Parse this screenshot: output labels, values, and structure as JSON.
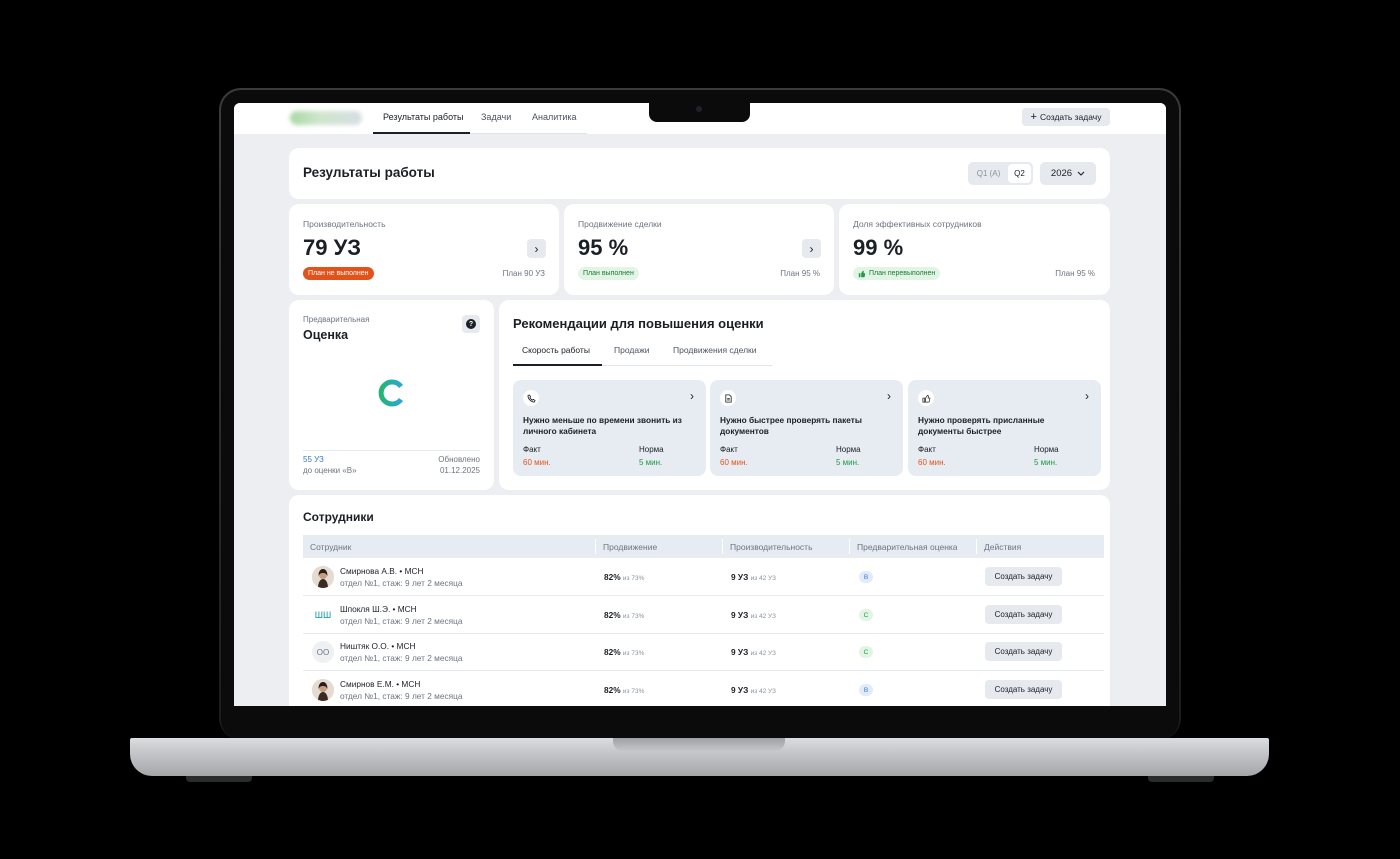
{
  "nav": {
    "tabs": [
      "Результаты работы",
      "Задачи",
      "Аналитика"
    ],
    "create_task": "Создать задачу"
  },
  "header": {
    "title": "Результаты работы",
    "periods": [
      "Q1 (А)",
      "Q2"
    ],
    "selected_period": "Q2",
    "year": "2026"
  },
  "kpis": [
    {
      "label": "Производительность",
      "value": "79 УЗ",
      "badge": "План не выполнен",
      "badge_status": "red",
      "plan": "План 90 УЗ"
    },
    {
      "label": "Продвижение сделки",
      "value": "95 %",
      "badge": "План выполнен",
      "badge_status": "green",
      "plan": "План 95 %"
    },
    {
      "label": "Доля эффективных сотрудников",
      "value": "99 %",
      "badge": "План перевыполнен",
      "badge_status": "green",
      "plan": "План 95 %"
    }
  ],
  "score": {
    "label": "Предварительная",
    "title": "Оценка",
    "grade": "C",
    "remaining": "55 УЗ",
    "remaining_sub": "до оценки «B»",
    "updated_label": "Обновлено",
    "updated_date": "01.12.2025"
  },
  "recommendations": {
    "title": "Рекомендации для повышения оценки",
    "tabs": [
      "Скорость работы",
      "Продажи",
      "Продвижения сделки"
    ],
    "cards": [
      {
        "icon": "phone-icon",
        "text": "Нужно меньше по времени звонить из личного кабинета",
        "fact_label": "Факт",
        "fact": "60 мин.",
        "norm_label": "Норма",
        "norm": "5 мин."
      },
      {
        "icon": "document-icon",
        "text": "Нужно быстрее проверять пакеты документов",
        "fact_label": "Факт",
        "fact": "60 мин.",
        "norm_label": "Норма",
        "norm": "5 мин."
      },
      {
        "icon": "thumbs-up-icon",
        "text": "Нужно проверять присланные документы быстрее",
        "fact_label": "Факт",
        "fact": "60 мин.",
        "norm_label": "Норма",
        "norm": "5 мин."
      }
    ]
  },
  "employees": {
    "title": "Сотрудники",
    "columns": [
      "Сотрудник",
      "Продвижение",
      "Производительность",
      "Предварительная оценка",
      "Действия"
    ],
    "rows": [
      {
        "avatar": "photo",
        "initials": "",
        "name": "Смирнова А.В. • МСН",
        "dept": "отдел №1, стаж: 9 лет 2 месяца",
        "promo": "82%",
        "promo_of": "из 73%",
        "prod": "9 УЗ",
        "prod_of": "из 42 УЗ",
        "grade": "B",
        "action": "Создать задачу"
      },
      {
        "avatar": "initials-cyan",
        "initials": "ШШ",
        "name": "Шпокля Ш.Э. • МСН",
        "dept": "отдел №1, стаж: 9 лет 2 месяца",
        "promo": "82%",
        "promo_of": "из 73%",
        "prod": "9 УЗ",
        "prod_of": "из 42 УЗ",
        "grade": "C",
        "action": "Создать задачу"
      },
      {
        "avatar": "initials-gray",
        "initials": "ОО",
        "name": "Ништяк О.О. • МСН",
        "dept": "отдел №1, стаж: 9 лет 2 месяца",
        "promo": "82%",
        "promo_of": "из 73%",
        "prod": "9 УЗ",
        "prod_of": "из 42 УЗ",
        "grade": "C",
        "action": "Создать задачу"
      },
      {
        "avatar": "photo",
        "initials": "",
        "name": "Смирнов Е.М. • МСН",
        "dept": "отдел №1, стаж: 9 лет 2 месяца",
        "promo": "82%",
        "promo_of": "из 73%",
        "prod": "9 УЗ",
        "prod_of": "из 42 УЗ",
        "grade": "B",
        "action": "Создать задачу"
      }
    ]
  },
  "colors": {
    "accent_red": "#e2531c",
    "accent_green": "#1f9a45",
    "link_blue": "#3b79c9",
    "grade_c_gradient": [
      "#22b573",
      "#2aa7d8"
    ]
  }
}
